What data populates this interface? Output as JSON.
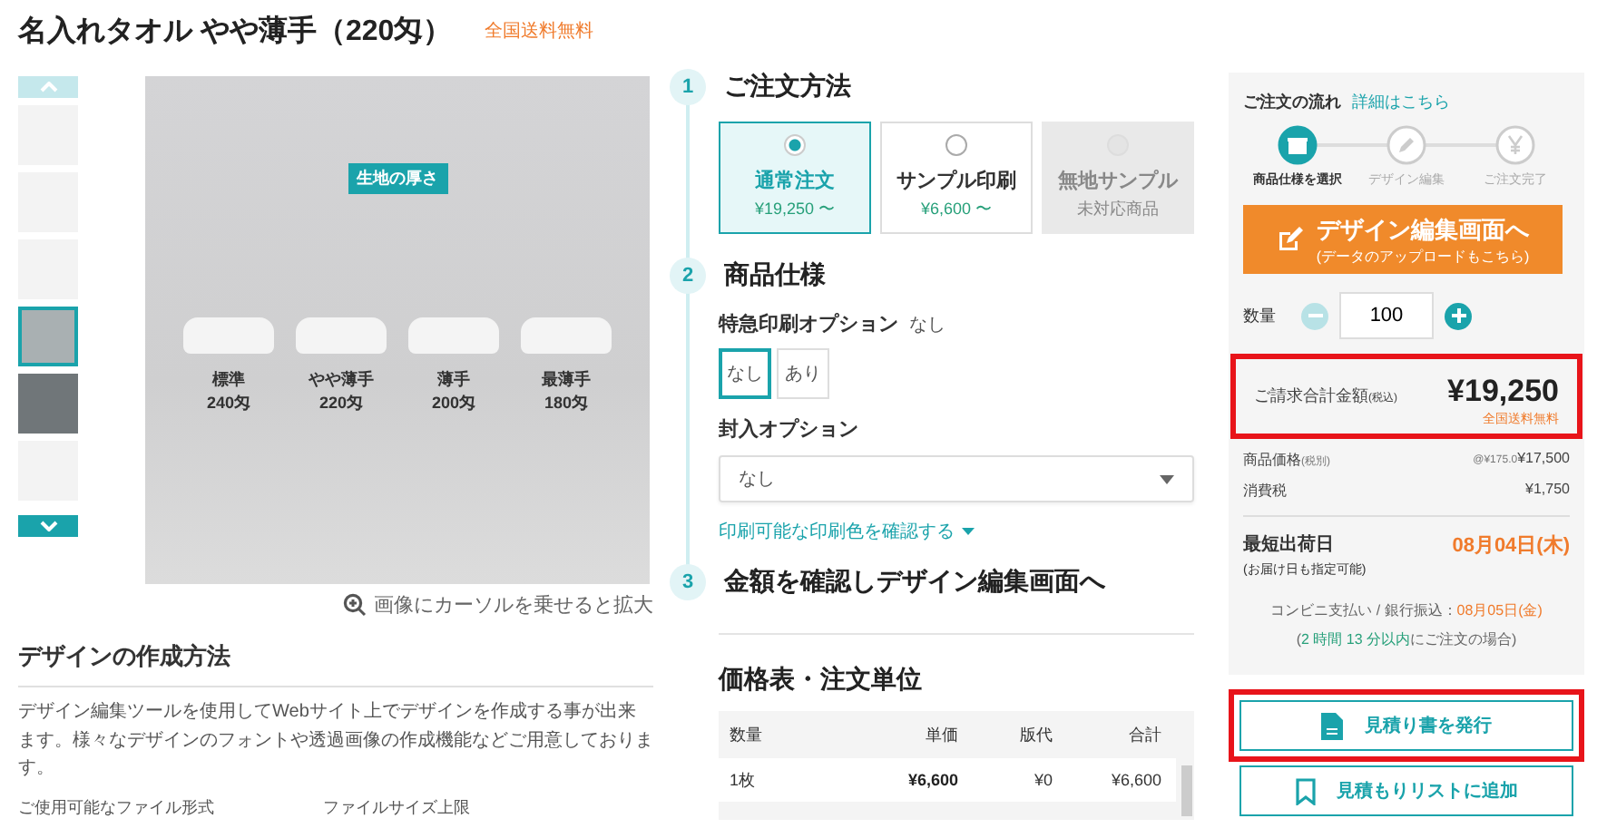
{
  "title": "名入れタオル やや薄手（220匁）",
  "shipping_badge": "全国送料無料",
  "gallery": {
    "thumbnails": [
      {
        "selected": false
      },
      {
        "selected": false
      },
      {
        "selected": false
      },
      {
        "selected": true
      },
      {
        "selected": false
      },
      {
        "selected": false
      }
    ],
    "image_tag": "生地の厚さ",
    "towels": [
      {
        "name": "標準",
        "weight": "240匁"
      },
      {
        "name": "やや薄手",
        "weight": "220匁"
      },
      {
        "name": "薄手",
        "weight": "200匁"
      },
      {
        "name": "最薄手",
        "weight": "180匁"
      }
    ],
    "zoom_hint": "画像にカーソルを乗せると拡大"
  },
  "design_section": {
    "heading": "デザインの作成方法",
    "text": "デザイン編集ツールを使用してWebサイト上でデザインを作成する事が出来ます。様々なデザインのフォントや透過画像の作成機能などご用意しております。",
    "column_1": "ご使用可能なファイル形式",
    "column_2": "ファイルサイズ上限"
  },
  "steps": [
    {
      "number": "1",
      "title": "ご注文方法"
    },
    {
      "number": "2",
      "title": "商品仕様"
    },
    {
      "number": "3",
      "title": "金額を確認しデザイン編集画面へ"
    }
  ],
  "order_methods": [
    {
      "label": "通常注文",
      "sub": "¥19,250 〜",
      "selected": true,
      "disabled": false
    },
    {
      "label": "サンプル印刷",
      "sub": "¥6,600 〜",
      "selected": false,
      "disabled": false
    },
    {
      "label": "無地サンプル",
      "sub": "未対応商品",
      "selected": false,
      "disabled": true
    }
  ],
  "rush_option": {
    "label": "特急印刷オプション",
    "value": "なし",
    "choices": [
      {
        "label": "なし",
        "selected": true
      },
      {
        "label": "あり",
        "selected": false
      }
    ]
  },
  "insert_option": {
    "label": "封入オプション",
    "value": "なし"
  },
  "color_link": "印刷可能な印刷色を確認する",
  "price_table": {
    "heading": "価格表・注文単位",
    "columns": [
      "数量",
      "単価",
      "版代",
      "合計"
    ],
    "rows": [
      [
        "1枚",
        "¥6,600",
        "¥0",
        "¥6,600"
      ]
    ]
  },
  "sidebar": {
    "flow_label": "ご注文の流れ",
    "flow_link": "詳細はこちら",
    "flow_steps": [
      {
        "label": "商品仕様を選択",
        "selected": true
      },
      {
        "label": "デザイン編集",
        "selected": false
      },
      {
        "label": "ご注文完了",
        "selected": false
      }
    ],
    "edit_button": {
      "label": "デザイン編集画面へ",
      "sub": "(データのアップロードもこちら)"
    },
    "quantity_label": "数量",
    "quantity": "100",
    "total": {
      "label": "ご請求合計金額",
      "note": "(税込)",
      "amount": "¥19,250",
      "shipping": "全国送料無料",
      "highlighted": true
    },
    "breakdown": [
      {
        "label": "商品価格",
        "note": "(税別)",
        "detail": "@¥175.0",
        "value": "¥17,500"
      },
      {
        "label": "消費税",
        "value": "¥1,750"
      }
    ],
    "ship_label": "最短出荷日",
    "ship_sub": "(お届け日も指定可能)",
    "ship_date": "08月04日(木)",
    "conv_label": "コンビニ支払い / 銀行振込：",
    "conv_date": "08月05日(金)",
    "deadline_open": "(",
    "deadline_time": "2 時間 13 分以内",
    "deadline_rest": "にご注文の場合)",
    "buttons": [
      {
        "kind": "document",
        "label": "見積り書を発行",
        "highlighted": true
      },
      {
        "kind": "bookmark",
        "label": "見積もりリストに追加",
        "highlighted": false
      }
    ]
  }
}
